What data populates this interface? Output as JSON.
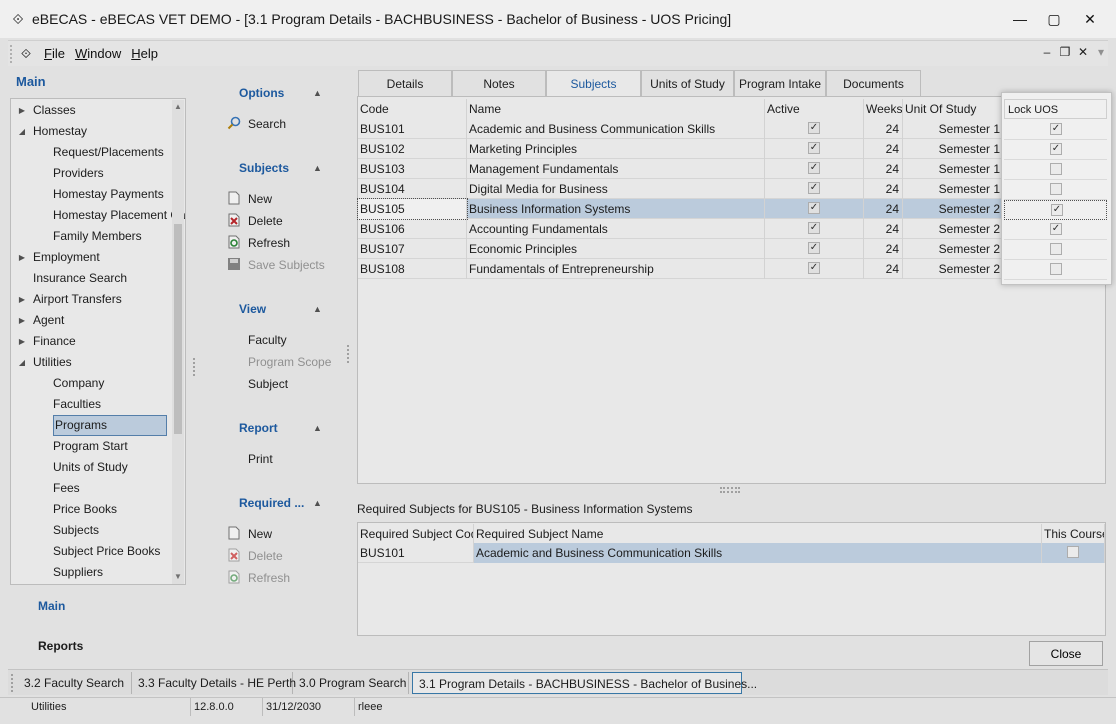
{
  "window": {
    "title": "eBECAS - eBECAS VET DEMO - [3.1 Program Details - BACHBUSINESS -  Bachelor of Business - UOS Pricing]"
  },
  "menu": {
    "items": [
      "File",
      "Window",
      "Help"
    ]
  },
  "nav": {
    "header": "Main",
    "items": [
      {
        "label": "Classes",
        "indent": 1,
        "expander": "collapsed"
      },
      {
        "label": "Homestay",
        "indent": 1,
        "expander": "expanded"
      },
      {
        "label": "Request/Placements",
        "indent": 2
      },
      {
        "label": "Providers",
        "indent": 2
      },
      {
        "label": "Homestay Payments",
        "indent": 2
      },
      {
        "label": "Homestay Placement Ca",
        "indent": 2
      },
      {
        "label": "Family Members",
        "indent": 2
      },
      {
        "label": "Employment",
        "indent": 1,
        "expander": "collapsed"
      },
      {
        "label": "Insurance Search",
        "indent": 1
      },
      {
        "label": "Airport Transfers",
        "indent": 1,
        "expander": "collapsed"
      },
      {
        "label": "Agent",
        "indent": 1,
        "expander": "collapsed"
      },
      {
        "label": "Finance",
        "indent": 1,
        "expander": "collapsed"
      },
      {
        "label": "Utilities",
        "indent": 1,
        "expander": "expanded"
      },
      {
        "label": "Company",
        "indent": 2
      },
      {
        "label": "Faculties",
        "indent": 2
      },
      {
        "label": "Programs",
        "indent": 2,
        "selected": true
      },
      {
        "label": "Program Start",
        "indent": 2
      },
      {
        "label": "Units of Study",
        "indent": 2
      },
      {
        "label": "Fees",
        "indent": 2
      },
      {
        "label": "Price Books",
        "indent": 2
      },
      {
        "label": "Subjects",
        "indent": 2
      },
      {
        "label": "Subject Price Books",
        "indent": 2
      },
      {
        "label": "Suppliers",
        "indent": 2
      }
    ],
    "footer_main": "Main",
    "footer_reports": "Reports"
  },
  "options": {
    "options_header": "Options",
    "search": "Search",
    "subjects_header": "Subjects",
    "new": "New",
    "delete": "Delete",
    "refresh": "Refresh",
    "save_subjects": "Save Subjects",
    "view_header": "View",
    "faculty": "Faculty",
    "program_scope": "Program Scope",
    "subject": "Subject",
    "report_header": "Report",
    "print": "Print",
    "required_header": "Required ...",
    "req_new": "New",
    "req_delete": "Delete",
    "req_refresh": "Refresh"
  },
  "tabs": [
    "Details",
    "Notes",
    "Subjects",
    "Units of Study",
    "Program Intake",
    "Documents"
  ],
  "active_tab": "Subjects",
  "grid": {
    "columns": {
      "code": "Code",
      "name": "Name",
      "active": "Active",
      "weeks": "Weeks",
      "uos": "Unit Of Study",
      "lock": "Lock UOS"
    },
    "rows": [
      {
        "code": "BUS101",
        "name": "Academic and Business Communication Skills",
        "active": true,
        "weeks": "24",
        "uos": "Semester 1",
        "lock": true
      },
      {
        "code": "BUS102",
        "name": "Marketing Principles",
        "active": true,
        "weeks": "24",
        "uos": "Semester 1",
        "lock": true
      },
      {
        "code": "BUS103",
        "name": "Management Fundamentals",
        "active": true,
        "weeks": "24",
        "uos": "Semester 1",
        "lock": false
      },
      {
        "code": "BUS104",
        "name": "Digital Media for Business",
        "active": true,
        "weeks": "24",
        "uos": "Semester 1",
        "lock": false
      },
      {
        "code": "BUS105",
        "name": "Business Information Systems",
        "active": true,
        "weeks": "24",
        "uos": "Semester 2",
        "lock": true,
        "selected": true
      },
      {
        "code": "BUS106",
        "name": "Accounting Fundamentals",
        "active": true,
        "weeks": "24",
        "uos": "Semester 2",
        "lock": true
      },
      {
        "code": "BUS107",
        "name": "Economic Principles",
        "active": true,
        "weeks": "24",
        "uos": "Semester 2",
        "lock": false
      },
      {
        "code": "BUS108",
        "name": "Fundamentals of Entrepreneurship",
        "active": true,
        "weeks": "24",
        "uos": "Semester 2",
        "lock": false
      }
    ]
  },
  "required": {
    "title": "Required Subjects for BUS105 - Business Information Systems",
    "columns": {
      "code": "Required Subject Code",
      "name": "Required Subject Name",
      "this_course": "This Course"
    },
    "rows": [
      {
        "code": "BUS101",
        "name": "Academic and Business Communication Skills",
        "this_course": false
      }
    ]
  },
  "close_label": "Close",
  "doc_tabs": [
    "3.2 Faculty Search",
    "3.3 Faculty Details - HE Perth",
    "3.0 Program Search",
    "3.1 Program Details - BACHBUSINESS -  Bachelor of Busines..."
  ],
  "status": {
    "module": "Utilities",
    "version": "12.8.0.0",
    "date": "31/12/2030",
    "user": "rleee"
  },
  "colors": {
    "accent": "#1f5fa8",
    "selection": "#c7d8ea"
  }
}
